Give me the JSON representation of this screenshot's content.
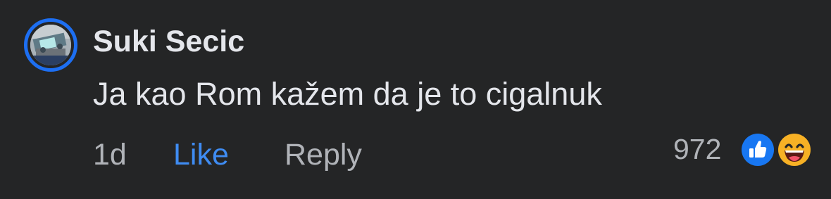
{
  "comment": {
    "author": "Suki Secic",
    "text": "Ja kao Rom kažem da je to cigalnuk",
    "time": "1d",
    "like_label": "Like",
    "reply_label": "Reply",
    "reaction_count": "972",
    "reactions": [
      "like-reaction-icon",
      "haha-reaction-icon"
    ]
  },
  "colors": {
    "background": "#242526",
    "primary_text": "#e4e6eb",
    "secondary_text": "#b0b3b8",
    "accent": "#3f8cf2",
    "avatar_ring": "#1d6ff2"
  }
}
